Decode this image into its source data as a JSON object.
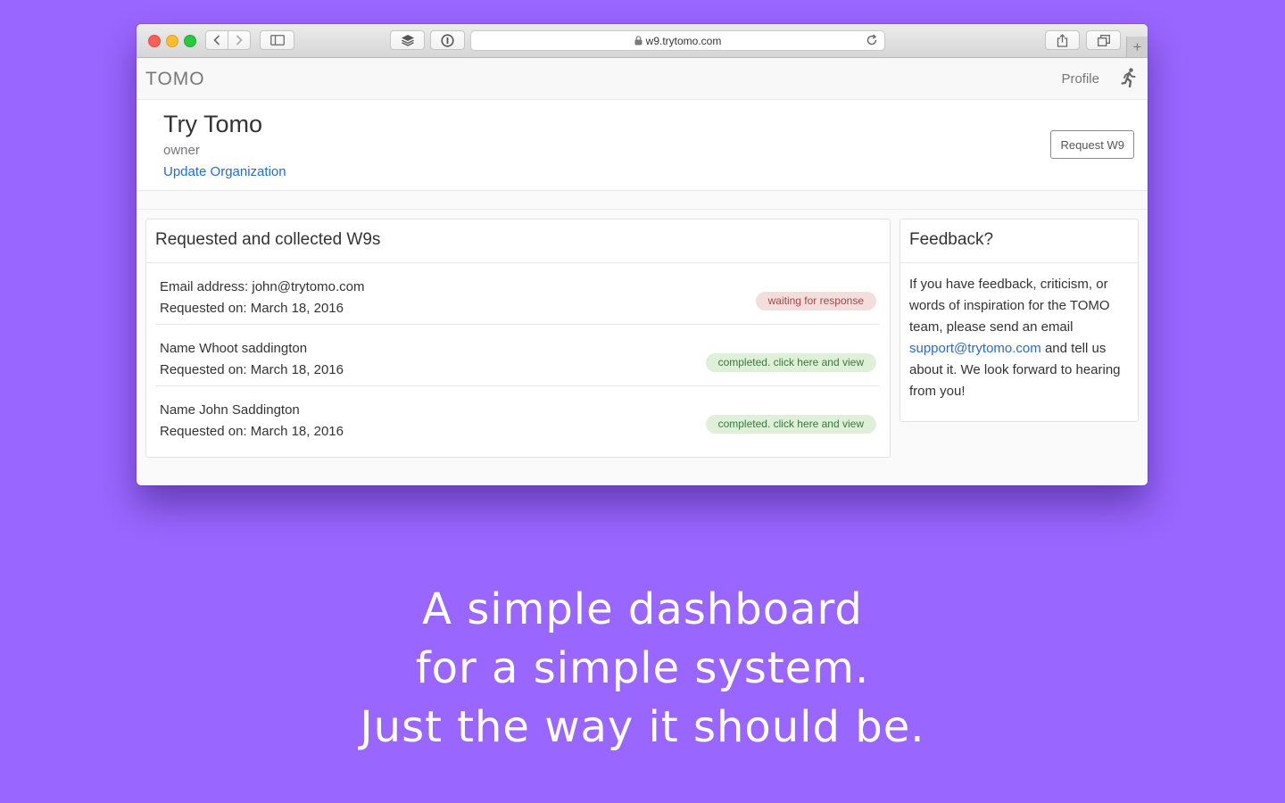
{
  "browser": {
    "url": "w9.trytomo.com",
    "new_tab": "+"
  },
  "navbar": {
    "brand": "TOMO",
    "profile_label": "Profile"
  },
  "organization": {
    "name": "Try Tomo",
    "role": "owner",
    "update_link": "Update Organization",
    "request_button": "Request W9"
  },
  "w9_panel": {
    "title": "Requested and collected W9s",
    "rows": [
      {
        "line1": "Email address: john@trytomo.com",
        "line2": "Requested on: March 18, 2016",
        "status": "waiting for response",
        "status_type": "waiting"
      },
      {
        "line1": "Name Whoot saddington",
        "line2": "Requested on: March 18, 2016",
        "status": "completed. click here and view",
        "status_type": "completed"
      },
      {
        "line1": "Name John Saddington",
        "line2": "Requested on: March 18, 2016",
        "status": "completed. click here and view",
        "status_type": "completed"
      }
    ]
  },
  "feedback_panel": {
    "title": "Feedback?",
    "text_before": "If you have feedback, criticism, or words of inspiration for the TOMO team, please send an email",
    "email": "support@trytomo.com",
    "text_after": "and tell us about it. We look forward to hearing from you!"
  },
  "tagline": {
    "line1": "A simple dashboard",
    "line2": "for a simple system.",
    "line3": "Just the way it should be."
  },
  "colors": {
    "background": "#9966ff",
    "link": "#2a6bbf",
    "waiting_badge": "#f3dede",
    "completed_badge": "#dff0d8"
  }
}
